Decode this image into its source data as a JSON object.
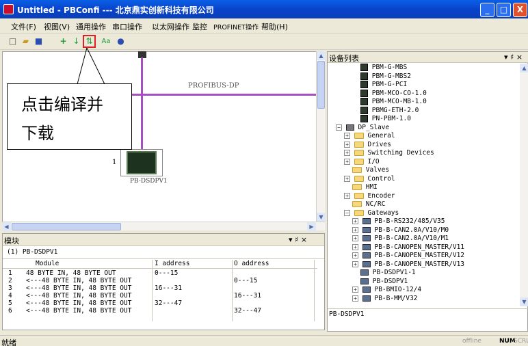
{
  "window": {
    "title": "Untitled - PBConfi --- 北京鼎实创新科技有限公司",
    "minimize": "_",
    "maximize": "□",
    "close": "X"
  },
  "menu": [
    "文件(F)",
    "视图(V)",
    "通用操作",
    "串口操作",
    "以太网操作",
    "监控",
    "PROFINET操作",
    "帮助(H)"
  ],
  "toolbar": {
    "icons": [
      "new-file-icon",
      "open-folder-icon",
      "save-icon",
      "add-icon",
      "download-arrow-icon",
      "compile-download-icon",
      "font-icon",
      "help-icon"
    ]
  },
  "canvas": {
    "bus_label": "PROFIBUS-DP",
    "device_number": "1",
    "device_label": "PB-DSDPV1"
  },
  "annotation": {
    "line1": "点击编译并",
    "line2": "下载"
  },
  "module_panel": {
    "title": "模块",
    "pin": "▾ ♯ ×",
    "device": "(1) PB-DSDPV1",
    "columns": [
      "Module",
      "I address",
      "O address"
    ],
    "rows": [
      {
        "num": "1",
        "module": "48 BYTE IN, 48 BYTE OUT",
        "i": "0---15",
        "o": ""
      },
      {
        "num": "2",
        "module": "<---48 BYTE IN, 48 BYTE OUT",
        "i": "",
        "o": "0---15"
      },
      {
        "num": "3",
        "module": "<---48 BYTE IN, 48 BYTE OUT",
        "i": "16---31",
        "o": ""
      },
      {
        "num": "4",
        "module": "<---48 BYTE IN, 48 BYTE OUT",
        "i": "",
        "o": "16---31"
      },
      {
        "num": "5",
        "module": "<---48 BYTE IN, 48 BYTE OUT",
        "i": "32---47",
        "o": ""
      },
      {
        "num": "6",
        "module": "<---48 BYTE IN, 48 BYTE OUT",
        "i": "",
        "o": "32---47"
      }
    ]
  },
  "device_panel": {
    "title": "设备列表",
    "pin": "▾ ♯ ×",
    "tree": [
      {
        "label": "PBM-G-MBS",
        "indent": 2,
        "icon": "device",
        "exp": ""
      },
      {
        "label": "PBM-G-MBS2",
        "indent": 2,
        "icon": "device",
        "exp": ""
      },
      {
        "label": "PBM-G-PCI",
        "indent": 2,
        "icon": "device",
        "exp": ""
      },
      {
        "label": "PBM-MCO-CO-1.0",
        "indent": 2,
        "icon": "device",
        "exp": ""
      },
      {
        "label": "PBM-MCO-MB-1.0",
        "indent": 2,
        "icon": "device",
        "exp": ""
      },
      {
        "label": "PBMG-ETH-2.0",
        "indent": 2,
        "icon": "device",
        "exp": ""
      },
      {
        "label": "PN-PBM-1.0",
        "indent": 2,
        "icon": "device",
        "exp": ""
      },
      {
        "label": "DP_Slave",
        "indent": 0,
        "icon": "slave",
        "exp": "-"
      },
      {
        "label": "General",
        "indent": 1,
        "icon": "folder",
        "exp": "+"
      },
      {
        "label": "Drives",
        "indent": 1,
        "icon": "folder",
        "exp": "+"
      },
      {
        "label": "Switching Devices",
        "indent": 1,
        "icon": "folder",
        "exp": "+"
      },
      {
        "label": "I/O",
        "indent": 1,
        "icon": "folder",
        "exp": "+"
      },
      {
        "label": "Valves",
        "indent": 1,
        "icon": "folder",
        "exp": ""
      },
      {
        "label": "Control",
        "indent": 1,
        "icon": "folder",
        "exp": "+"
      },
      {
        "label": "HMI",
        "indent": 1,
        "icon": "folder",
        "exp": ""
      },
      {
        "label": "Encoder",
        "indent": 1,
        "icon": "folder",
        "exp": "+"
      },
      {
        "label": "NC/RC",
        "indent": 1,
        "icon": "folder",
        "exp": ""
      },
      {
        "label": "Gateways",
        "indent": 1,
        "icon": "folder",
        "exp": "-"
      },
      {
        "label": "PB-B-RS232/485/V35",
        "indent": 2,
        "icon": "gateway",
        "exp": "+"
      },
      {
        "label": "PB-B-CAN2.0A/V10/M0",
        "indent": 2,
        "icon": "gateway",
        "exp": "+"
      },
      {
        "label": "PB-B-CAN2.0A/V10/M1",
        "indent": 2,
        "icon": "gateway",
        "exp": "+"
      },
      {
        "label": "PB-B-CANOPEN_MASTER/V11",
        "indent": 2,
        "icon": "gateway",
        "exp": "+"
      },
      {
        "label": "PB-B-CANOPEN_MASTER/V12",
        "indent": 2,
        "icon": "gateway",
        "exp": "+"
      },
      {
        "label": "PB-B-CANOPEN_MASTER/V13",
        "indent": 2,
        "icon": "gateway",
        "exp": "+"
      },
      {
        "label": "PB-DSDPV1-1",
        "indent": 2,
        "icon": "gateway",
        "exp": ""
      },
      {
        "label": "PB-DSDPV1",
        "indent": 2,
        "icon": "gateway",
        "exp": ""
      },
      {
        "label": "PB-BMIO-12/4",
        "indent": 2,
        "icon": "gateway",
        "exp": "+"
      },
      {
        "label": "PB-B-MM/V32",
        "indent": 2,
        "icon": "gateway",
        "exp": "+"
      }
    ],
    "selected": "PB-DSDPV1"
  },
  "status": {
    "left": "就绪",
    "offline": "offline",
    "num": "NUM",
    "scrl": "SCRL"
  }
}
